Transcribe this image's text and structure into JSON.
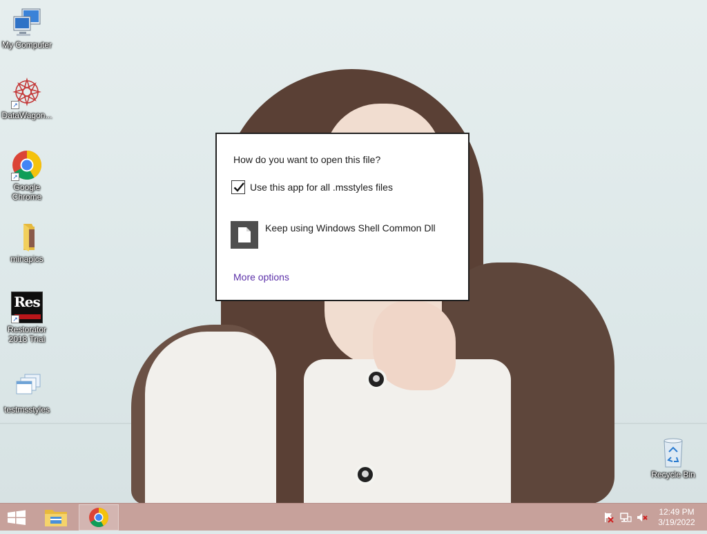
{
  "desktop": {
    "icons": [
      {
        "label": "My Computer",
        "icon": "my-computer-icon"
      },
      {
        "label": "DataWagon...",
        "icon": "datawagon-icon"
      },
      {
        "label": "Google Chrome",
        "icon": "chrome-icon"
      },
      {
        "label": "minapics",
        "icon": "folder-icon"
      },
      {
        "label": "Restorator 2018 Trial",
        "icon": "restorator-icon"
      },
      {
        "label": "testmsstyles",
        "icon": "msstyles-file-icon"
      },
      {
        "label": "Recycle Bin",
        "icon": "recycle-bin-icon"
      }
    ],
    "restorator_logo_text": "Res"
  },
  "dialog": {
    "title": "How do you want to open this file?",
    "checkbox_label": "Use this app for all .msstyles files",
    "checkbox_checked": true,
    "app_option": "Keep using Windows Shell Common Dll",
    "more_options": "More options"
  },
  "taskbar": {
    "apps": [
      "start-icon",
      "file-explorer-icon",
      "chrome-icon"
    ],
    "tray_icons": [
      "action-center-flag-icon",
      "network-icon",
      "volume-muted-icon"
    ],
    "time": "12:49 PM",
    "date": "3/19/2022"
  },
  "colors": {
    "taskbar": "#c49a94",
    "link": "#5b2fa8",
    "dialog_border": "#1f1f1f"
  }
}
